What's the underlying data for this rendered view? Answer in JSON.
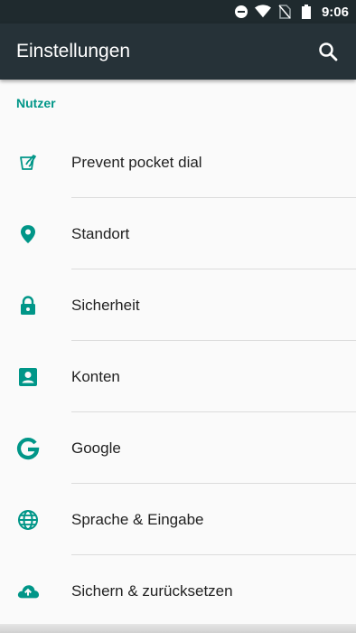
{
  "status_bar": {
    "time": "9:06",
    "icons": [
      "do-not-disturb-icon",
      "wifi-icon",
      "no-sim-icon",
      "battery-icon"
    ]
  },
  "app_bar": {
    "title": "Einstellungen",
    "search_icon": "search-icon"
  },
  "section": {
    "header": "Nutzer"
  },
  "items": [
    {
      "label": "Prevent pocket dial",
      "icon": "pocket-hand-icon"
    },
    {
      "label": "Standort",
      "icon": "location-pin-icon"
    },
    {
      "label": "Sicherheit",
      "icon": "lock-icon"
    },
    {
      "label": "Konten",
      "icon": "account-box-icon"
    },
    {
      "label": "Google",
      "icon": "google-icon"
    },
    {
      "label": "Sprache & Eingabe",
      "icon": "globe-icon"
    },
    {
      "label": "Sichern & zurücksetzen",
      "icon": "cloud-upload-icon"
    }
  ],
  "colors": {
    "accent": "#009688",
    "app_bar": "#263238",
    "status_bar": "#1f2a2e",
    "background": "#fafafa",
    "text": "#212121",
    "divider": "#dcdcdc"
  }
}
